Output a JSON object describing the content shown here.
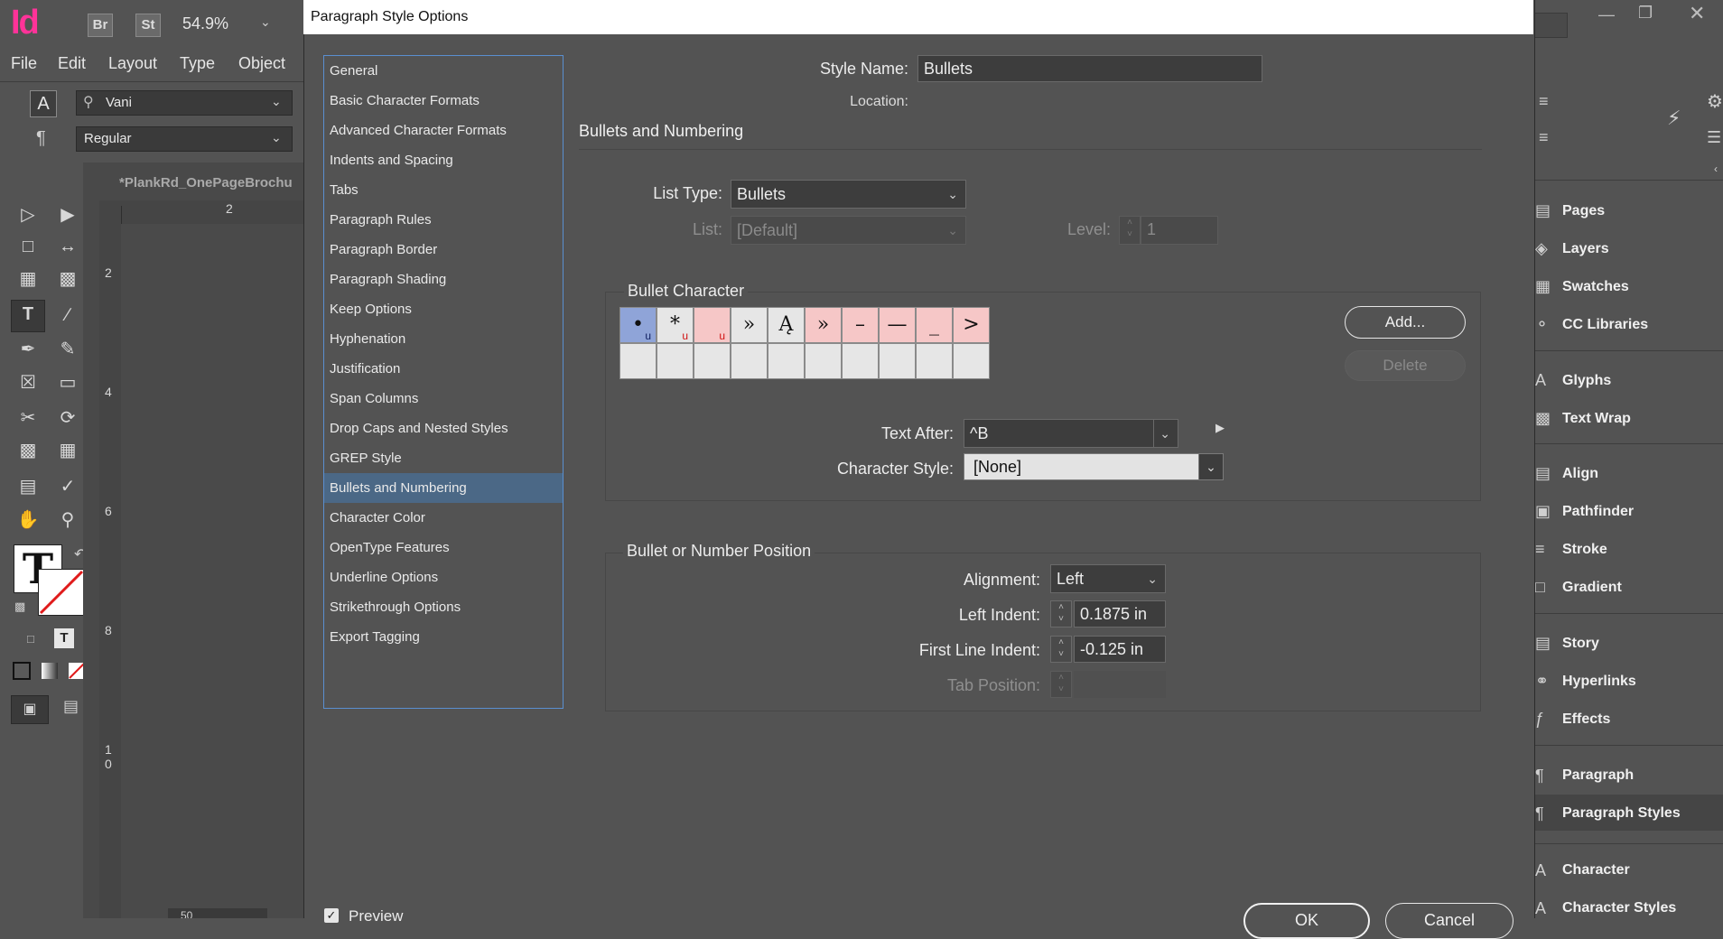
{
  "app": {
    "logo": "Id",
    "bridge_label": "Br",
    "stock_label": "St",
    "zoom": "54.9%",
    "menu": [
      "File",
      "Edit",
      "Layout",
      "Type",
      "Object"
    ],
    "font_family": "Vani",
    "font_style": "Regular",
    "document_tab": "*PlankRd_OnePageBrochu",
    "ruler_h_tick": "2",
    "ruler_v_ticks": [
      "2",
      "4",
      "6",
      "8",
      "1\n0"
    ],
    "page_field": "50"
  },
  "right_panels": [
    {
      "icon": "pages-icon",
      "label": "Pages"
    },
    {
      "icon": "layers-icon",
      "label": "Layers"
    },
    {
      "icon": "swatches-icon",
      "label": "Swatches"
    },
    {
      "icon": "cc-libraries-icon",
      "label": "CC Libraries"
    },
    {
      "icon": "glyphs-icon",
      "label": "Glyphs"
    },
    {
      "icon": "text-wrap-icon",
      "label": "Text Wrap"
    },
    {
      "icon": "align-icon",
      "label": "Align"
    },
    {
      "icon": "pathfinder-icon",
      "label": "Pathfinder"
    },
    {
      "icon": "stroke-icon",
      "label": "Stroke"
    },
    {
      "icon": "gradient-icon",
      "label": "Gradient"
    },
    {
      "icon": "story-icon",
      "label": "Story"
    },
    {
      "icon": "hyperlinks-icon",
      "label": "Hyperlinks"
    },
    {
      "icon": "effects-icon",
      "label": "Effects"
    },
    {
      "icon": "paragraph-icon",
      "label": "Paragraph"
    },
    {
      "icon": "paragraph-styles-icon",
      "label": "Paragraph Styles"
    },
    {
      "icon": "character-icon",
      "label": "Character"
    },
    {
      "icon": "character-styles-icon",
      "label": "Character Styles"
    }
  ],
  "dialog": {
    "title": "Paragraph Style Options",
    "nav": [
      "General",
      "Basic Character Formats",
      "Advanced Character Formats",
      "Indents and Spacing",
      "Tabs",
      "Paragraph Rules",
      "Paragraph Border",
      "Paragraph Shading",
      "Keep Options",
      "Hyphenation",
      "Justification",
      "Span Columns",
      "Drop Caps and Nested Styles",
      "GREP Style",
      "Bullets and Numbering",
      "Character Color",
      "OpenType Features",
      "Underline Options",
      "Strikethrough Options",
      "Export Tagging"
    ],
    "selected_nav": "Bullets and Numbering",
    "style_name_label": "Style Name:",
    "style_name_value": "Bullets",
    "location_label": "Location:",
    "section_title": "Bullets and Numbering",
    "list_type_label": "List Type:",
    "list_type_value": "Bullets",
    "list_label": "List:",
    "list_value": "[Default]",
    "level_label": "Level:",
    "level_value": "1",
    "bullet_char": {
      "title": "Bullet Character",
      "glyphs": [
        "•",
        "*",
        "",
        "»",
        "Ą",
        "»",
        "–",
        "—",
        "_",
        ">"
      ],
      "subscripts": [
        "u",
        "u",
        "u",
        "",
        "",
        "",
        "",
        "",
        "",
        ""
      ],
      "add_label": "Add...",
      "delete_label": "Delete",
      "text_after_label": "Text After:",
      "text_after_value": "^B",
      "char_style_label": "Character Style:",
      "char_style_value": "[None]"
    },
    "position": {
      "title": "Bullet or Number Position",
      "alignment_label": "Alignment:",
      "alignment_value": "Left",
      "left_indent_label": "Left Indent:",
      "left_indent_value": "0.1875 in",
      "first_line_label": "First Line Indent:",
      "first_line_value": "-0.125 in",
      "tab_position_label": "Tab Position:"
    },
    "preview_label": "Preview",
    "ok_label": "OK",
    "cancel_label": "Cancel"
  }
}
